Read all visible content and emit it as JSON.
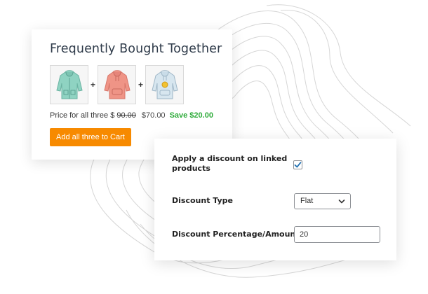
{
  "fbt": {
    "title": "Frequently Bought Together",
    "products": [
      {
        "icon": "hoodie-icon",
        "color": "#8fd3c2"
      },
      {
        "icon": "hoodie-icon",
        "color": "#ef9486"
      },
      {
        "icon": "hoodie-icon",
        "color": "#c9dce8"
      }
    ],
    "plus": "+",
    "price_label": "Price for all three $ ",
    "old_price": "90.00",
    "new_price": "$70.00",
    "save_label": "Save $20.00",
    "add_button": "Add all three to Cart"
  },
  "settings": {
    "apply_label": "Apply a discount on linked products",
    "apply_checked": true,
    "discount_type_label": "Discount Type",
    "discount_type_value": "Flat",
    "amount_label": "Discount Percentage/Amount",
    "amount_value": "20"
  },
  "colors": {
    "accent_button": "#f78a00",
    "save_green": "#2eab3a",
    "checkbox_blue": "#2271b1"
  }
}
